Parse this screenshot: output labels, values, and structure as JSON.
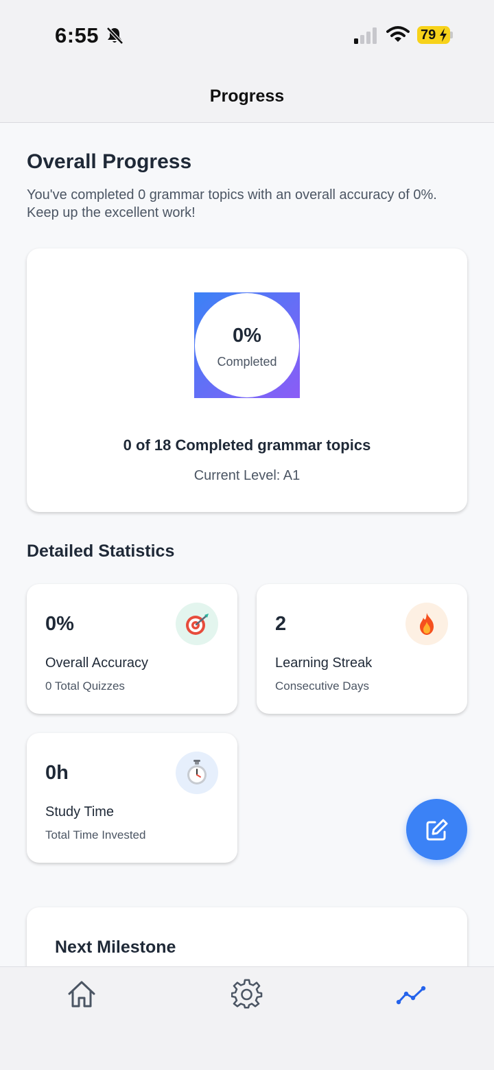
{
  "status_bar": {
    "time": "6:55",
    "battery": "79"
  },
  "header": {
    "title": "Progress"
  },
  "overview": {
    "title": "Overall Progress",
    "description": "You've completed 0 grammar topics with an overall accuracy of 0%. Keep up the excellent work!",
    "progress_percent": "0%",
    "progress_fraction": 0,
    "progress_label": "Completed",
    "topics_summary": "0 of 18 Completed grammar topics",
    "current_level": "Current Level: A1"
  },
  "stats": {
    "title": "Detailed Statistics",
    "accuracy": {
      "value": "0%",
      "label": "Overall Accuracy",
      "sub": "0 Total Quizzes",
      "icon": "target-icon"
    },
    "streak": {
      "value": "2",
      "label": "Learning Streak",
      "sub": "Consecutive Days",
      "icon": "fire-icon"
    },
    "study_time": {
      "value": "0h",
      "label": "Study Time",
      "sub": "Total Time Invested",
      "icon": "stopwatch-icon"
    }
  },
  "milestone": {
    "title": "Next Milestone"
  },
  "tabs": [
    {
      "name": "home",
      "icon": "home-icon",
      "active": false
    },
    {
      "name": "settings",
      "icon": "gear-icon",
      "active": false
    },
    {
      "name": "progress",
      "icon": "trend-chart-icon",
      "active": true
    }
  ],
  "colors": {
    "accent": "#3b82f6",
    "gradient_end": "#8b5cf6",
    "tab_active": "#2563eb",
    "tab_inactive": "#4b5563"
  }
}
